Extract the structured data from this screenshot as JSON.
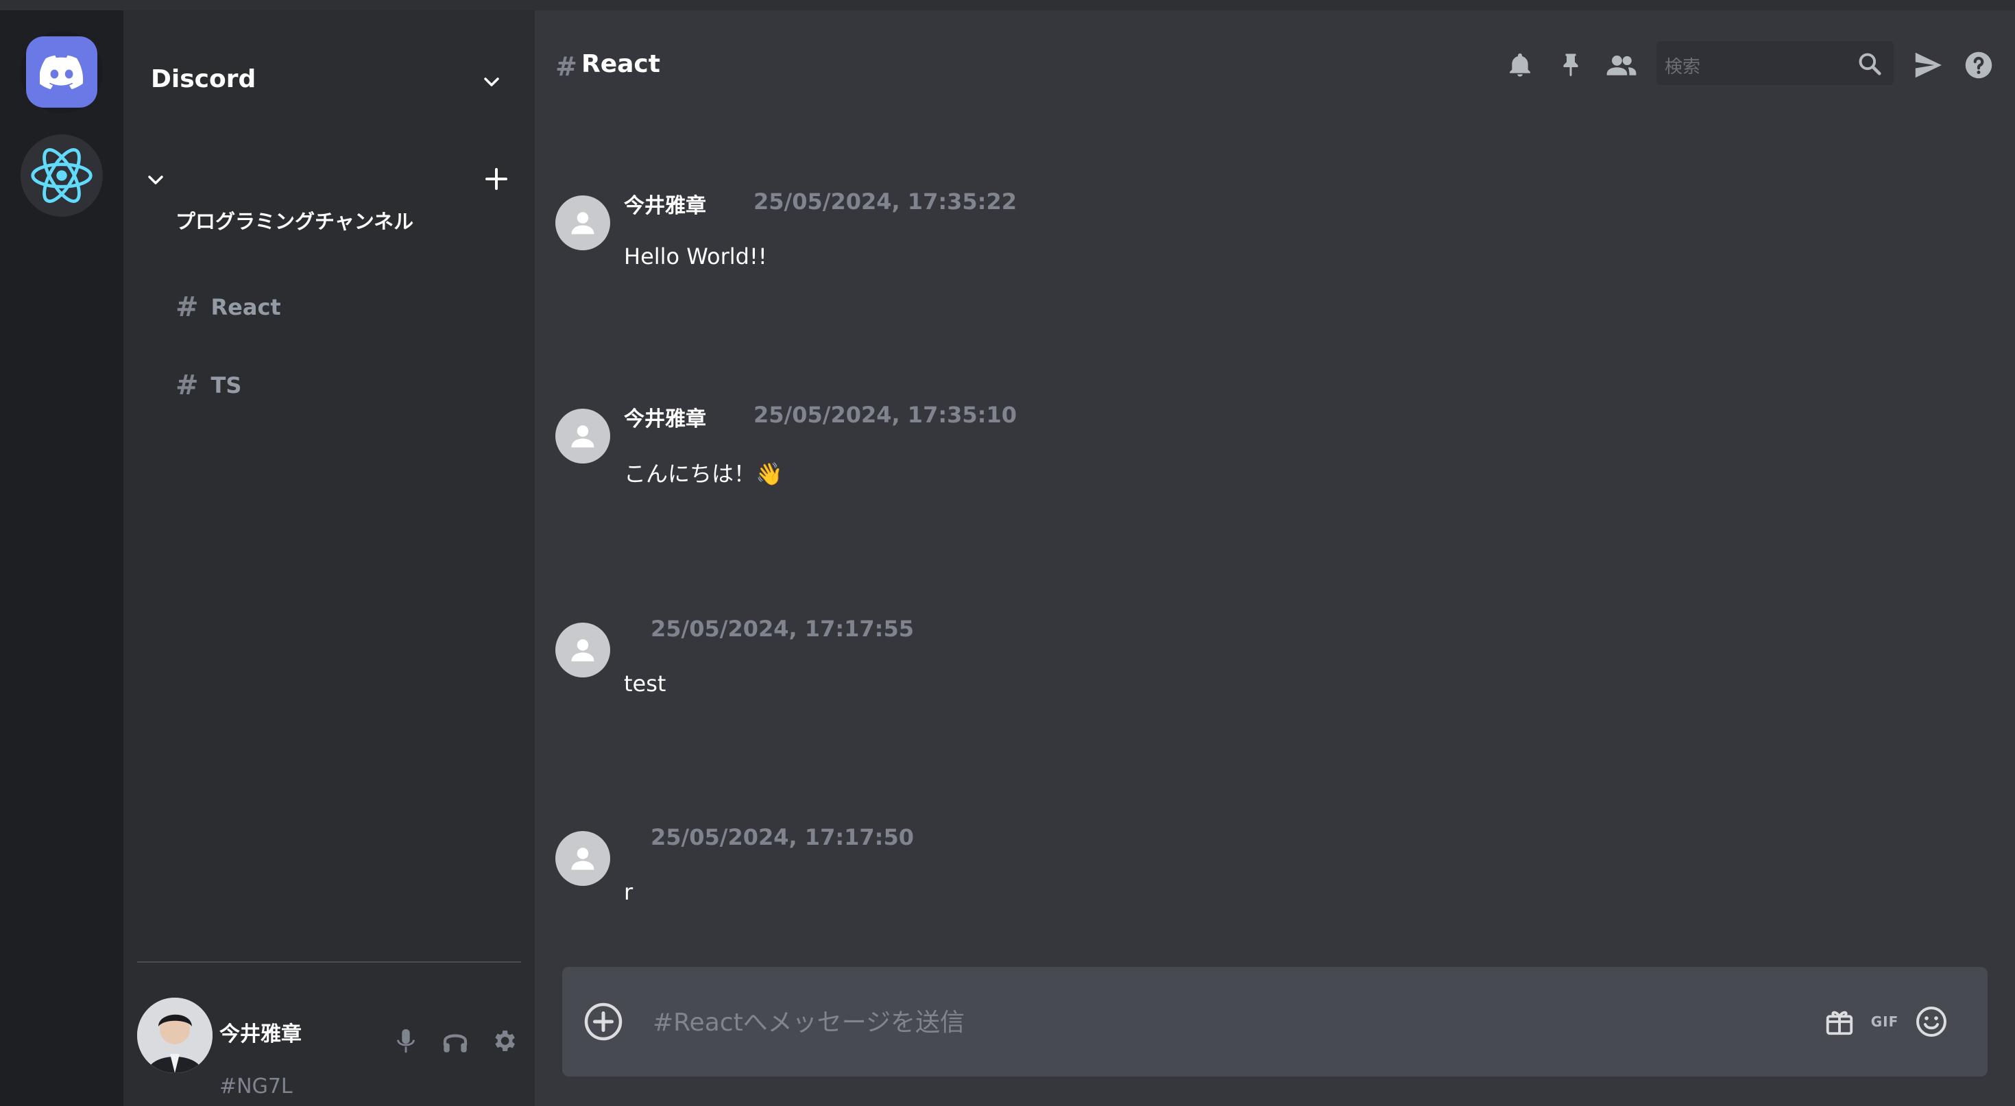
{
  "server_name": "Discord",
  "category": "プログラミングチャンネル",
  "channels": [
    {
      "hash": "#",
      "name": "React"
    },
    {
      "hash": "#",
      "name": "TS"
    }
  ],
  "current_channel": {
    "hash": "#",
    "name": "React"
  },
  "search_placeholder": "検索",
  "messages": [
    {
      "author": "今井雅章",
      "time": "25/05/2024, 17:35:22",
      "text": "Hello World!!"
    },
    {
      "author": "今井雅章",
      "time": "25/05/2024, 17:35:10",
      "text": "こんにちは！👋"
    },
    {
      "author": "",
      "time": "25/05/2024, 17:17:55",
      "text": "test"
    },
    {
      "author": "",
      "time": "25/05/2024, 17:17:50",
      "text": "r"
    }
  ],
  "composer_placeholder": "#Reactへメッセージを送信",
  "composer_gif": "GIF",
  "user": {
    "name": "今井雅章",
    "tag": "#NG7L"
  },
  "colors": {
    "accent": "#6a79e6",
    "react": "#61dafb",
    "rail": "#1e1f22",
    "sidebar": "#2b2d31",
    "main": "#36373d"
  },
  "icons": [
    "discord-icon",
    "react-icon",
    "chevron-down-icon",
    "plus-icon",
    "bell-icon",
    "pin-icon",
    "members-icon",
    "search-icon",
    "send-icon",
    "help-icon",
    "mic-icon",
    "headphones-icon",
    "gear-icon",
    "add-circle-icon",
    "gift-icon",
    "gif-icon",
    "emoji-icon",
    "user-icon"
  ]
}
